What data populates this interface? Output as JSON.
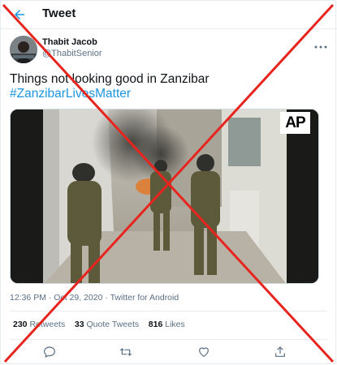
{
  "header": {
    "title": "Tweet"
  },
  "author": {
    "name": "Thabit Jacob",
    "handle": "@ThabitSenior"
  },
  "tweet": {
    "text": "Things not looking good in Zanzibar",
    "hashtag": "#ZanzibarLivesMatter",
    "media_badge": "AP"
  },
  "meta": {
    "time": "12:36 PM",
    "separator": "·",
    "date": "Oct 29, 2020",
    "source": "Twitter for Android"
  },
  "stats": {
    "retweets_count": "230",
    "retweets_label": "Retweets",
    "quotes_count": "33",
    "quotes_label": "Quote Tweets",
    "likes_count": "816",
    "likes_label": "Likes"
  },
  "colors": {
    "accent": "#1b95e0",
    "cross": "#e8241e"
  }
}
